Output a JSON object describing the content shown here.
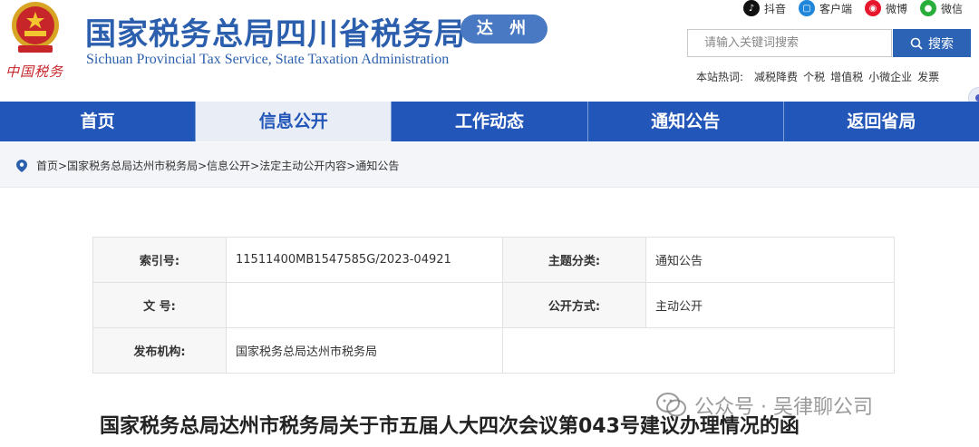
{
  "header": {
    "title": "国家税务总局四川省税务局",
    "city": "达 州",
    "subtitle": "Sichuan Provincial Tax Service, State Taxation Administration",
    "brand_script": "中国税务"
  },
  "social": [
    {
      "label": "抖音",
      "icon": "douyin-icon",
      "color": "#111111"
    },
    {
      "label": "客户端",
      "icon": "client-app-icon",
      "color": "#1f86d9"
    },
    {
      "label": "微博",
      "icon": "weibo-icon",
      "color": "#e6162d"
    },
    {
      "label": "微信",
      "icon": "wechat-icon",
      "color": "#2aae3b"
    }
  ],
  "search": {
    "placeholder": "请输入关键词搜索",
    "button_label": "搜索"
  },
  "hot_words": {
    "label": "本站热词:",
    "items": [
      "减税降费",
      "个税",
      "增值税",
      "小微企业",
      "发票"
    ]
  },
  "nav": {
    "items": [
      "首页",
      "信息公开",
      "工作动态",
      "通知公告",
      "返回省局"
    ],
    "active_index": 1
  },
  "breadcrumb": [
    "首页",
    "国家税务总局达州市税务局",
    "信息公开",
    "法定主动公开内容",
    "通知公告"
  ],
  "info": {
    "index_label": "索引号:",
    "index_value": "11511400MB1547585G/2023-04921",
    "topic_label": "主题分类:",
    "topic_value": "通知公告",
    "docno_label": "文 号:",
    "docno_value": "",
    "method_label": "公开方式:",
    "method_value": "主动公开",
    "issuer_label": "发布机构:",
    "issuer_value": "国家税务总局达州市税务局"
  },
  "document_title": "国家税务总局达州市税务局关于市五届人大四次会议第043号建议办理情况的函",
  "watermark": "公众号 · 吴律聊公司",
  "colors": {
    "brand_blue": "#2b5fae",
    "nav_blue": "#2256b8",
    "nav_active_bg": "#e9edf6",
    "emblem_red": "#c6262a"
  }
}
